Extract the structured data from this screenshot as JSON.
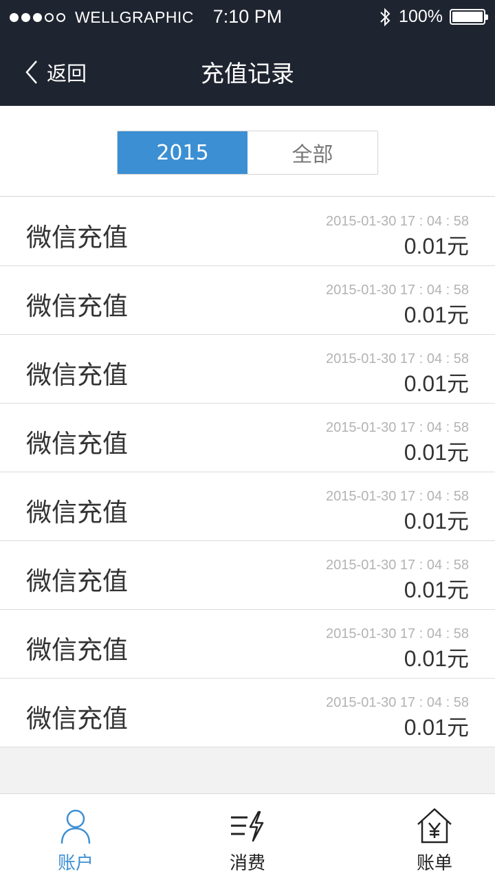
{
  "status_bar": {
    "carrier": "WELLGRAPHIC",
    "time": "7:10 PM",
    "battery": "100%",
    "signal_bars_filled": 3,
    "signal_bars_total": 5
  },
  "nav": {
    "back_label": "返回",
    "title": "充值记录"
  },
  "filter": {
    "options": [
      {
        "label": "2015",
        "selected": true
      },
      {
        "label": "全部",
        "selected": false
      }
    ]
  },
  "records": [
    {
      "type": "微信充值",
      "time": "2015-01-30 17 : 04 : 58",
      "amount": "0.01",
      "unit": "元"
    },
    {
      "type": "微信充值",
      "time": "2015-01-30 17 : 04 : 58",
      "amount": "0.01",
      "unit": "元"
    },
    {
      "type": "微信充值",
      "time": "2015-01-30 17 : 04 : 58",
      "amount": "0.01",
      "unit": "元"
    },
    {
      "type": "微信充值",
      "time": "2015-01-30 17 : 04 : 58",
      "amount": "0.01",
      "unit": "元"
    },
    {
      "type": "微信充值",
      "time": "2015-01-30 17 : 04 : 58",
      "amount": "0.01",
      "unit": "元"
    },
    {
      "type": "微信充值",
      "time": "2015-01-30 17 : 04 : 58",
      "amount": "0.01",
      "unit": "元"
    },
    {
      "type": "微信充值",
      "time": "2015-01-30 17 : 04 : 58",
      "amount": "0.01",
      "unit": "元"
    },
    {
      "type": "微信充值",
      "time": "2015-01-30 17 : 04 : 58",
      "amount": "0.01",
      "unit": "元"
    }
  ],
  "tabs": [
    {
      "label": "账户",
      "icon": "person-icon",
      "active": true
    },
    {
      "label": "消费",
      "icon": "consume-icon",
      "active": false
    },
    {
      "label": "账单",
      "icon": "bill-house-icon",
      "active": false
    }
  ],
  "colors": {
    "header_bg": "#1f2530",
    "accent": "#3c8fd3",
    "page_bg": "#f2f2f2"
  }
}
